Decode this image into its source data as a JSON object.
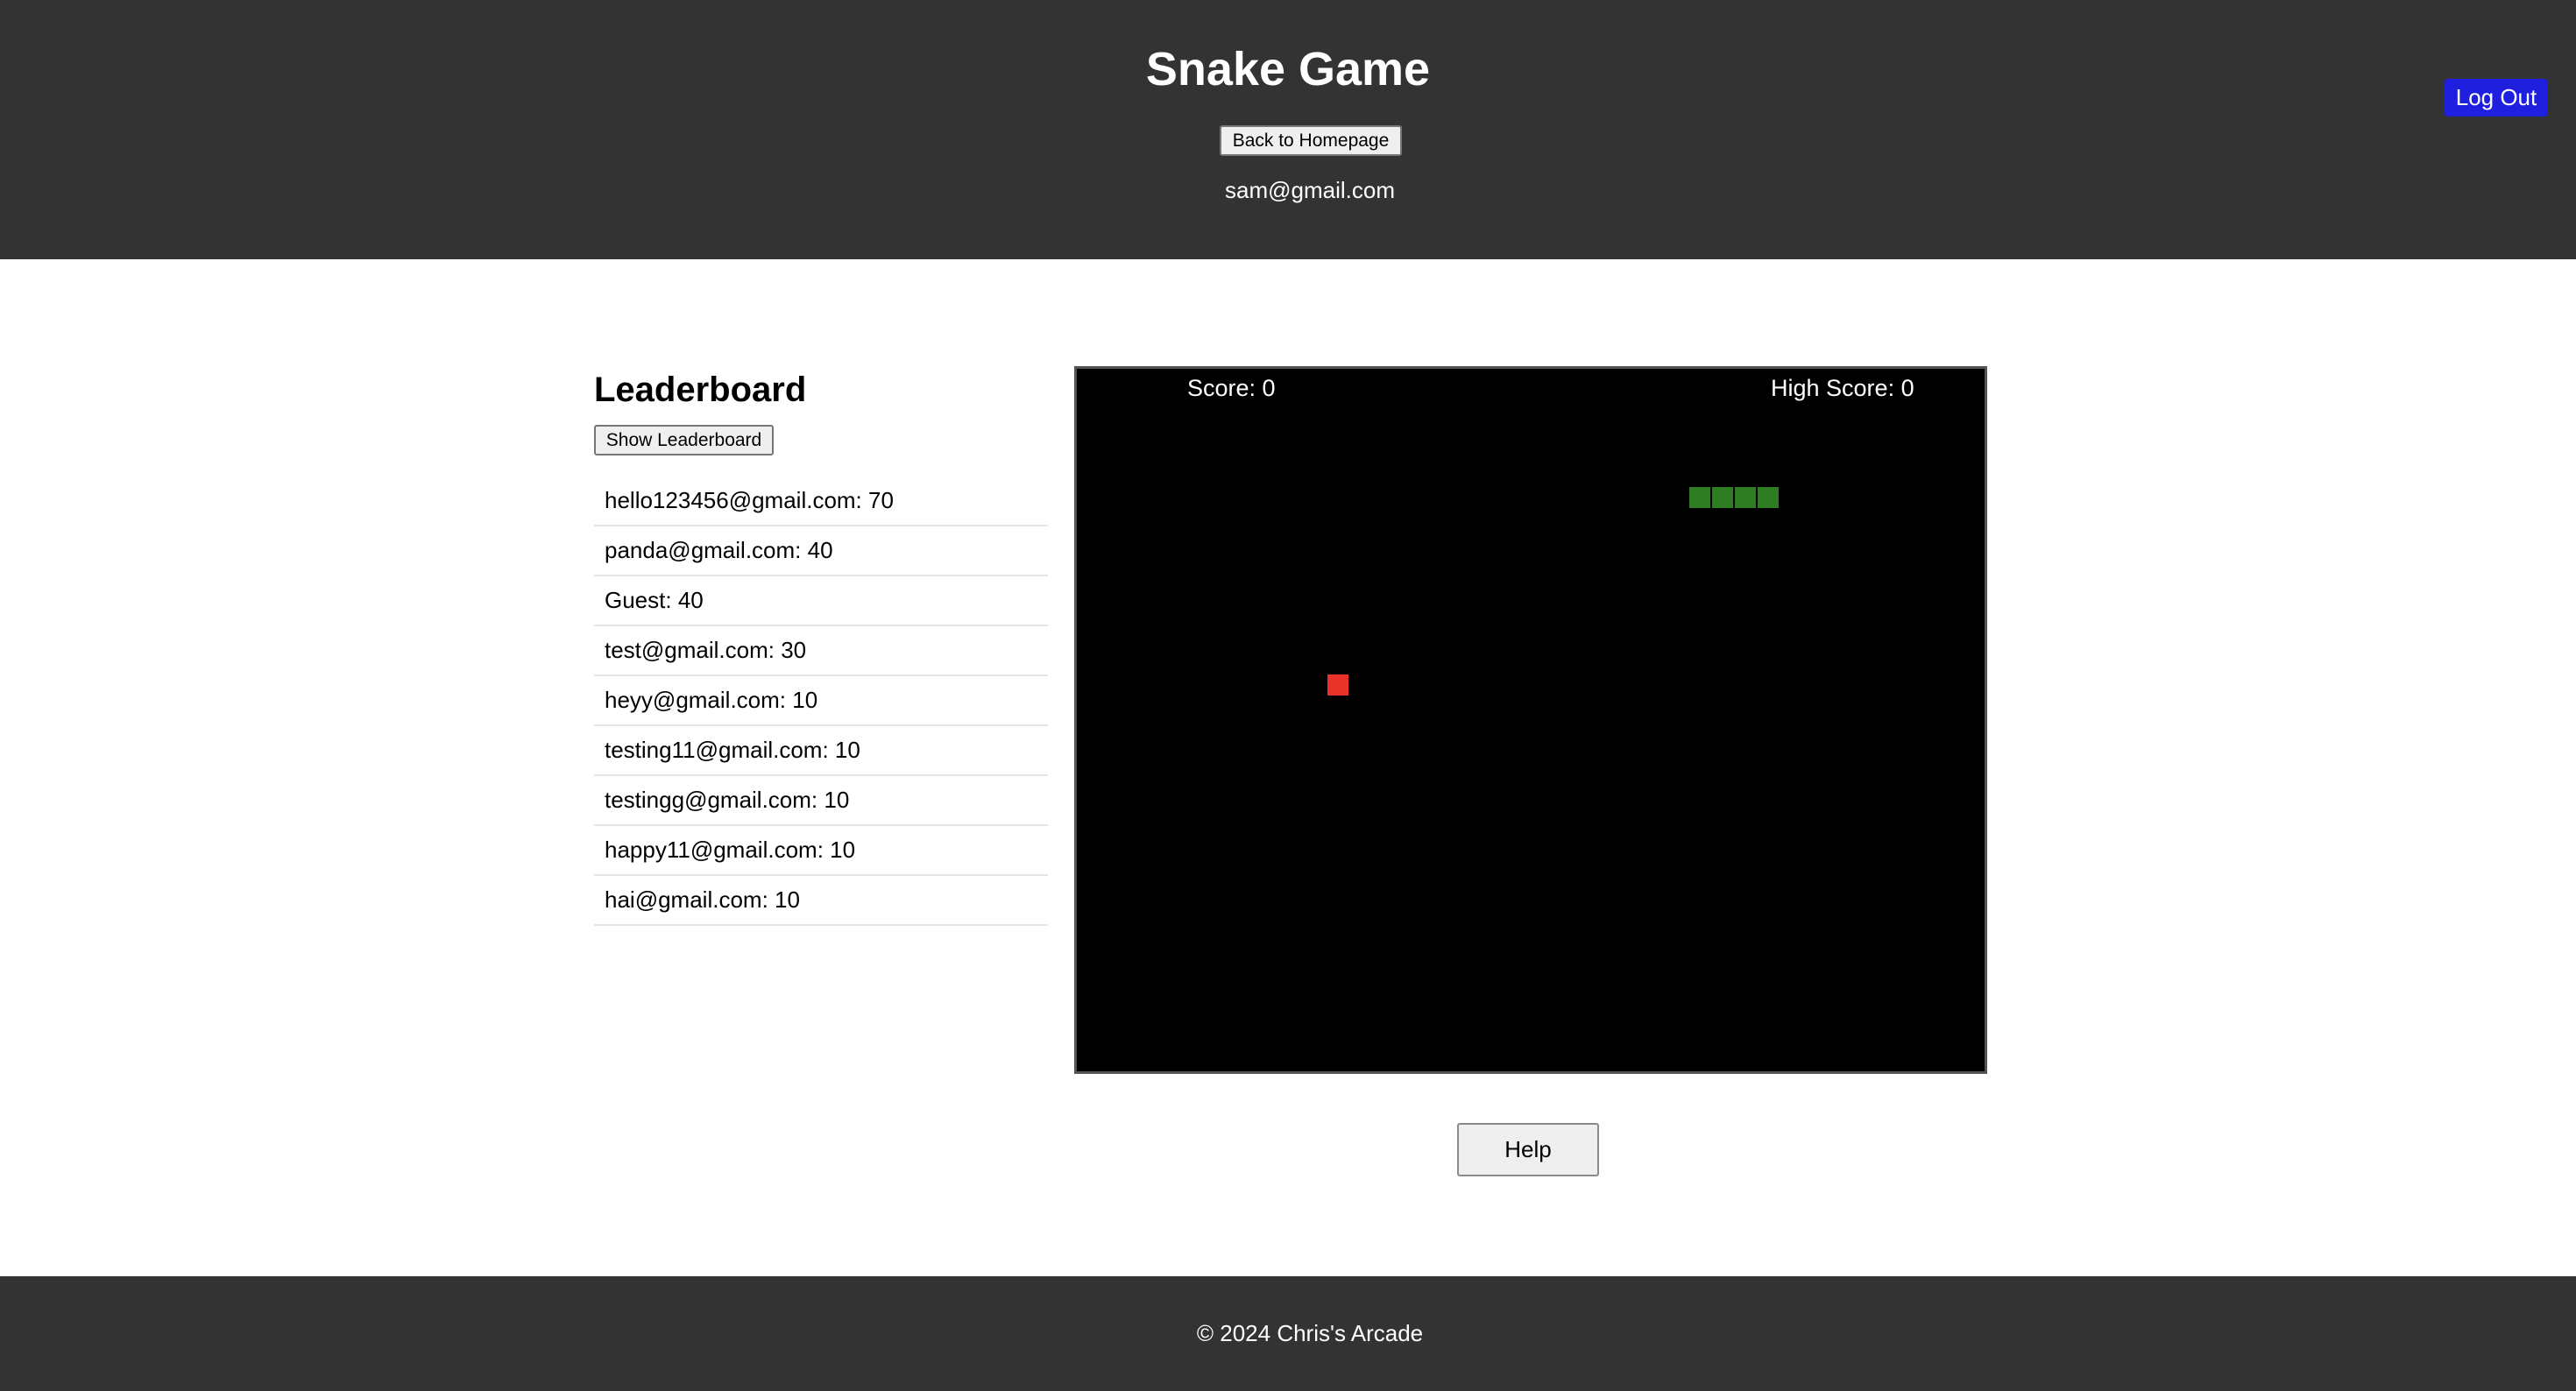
{
  "header": {
    "title": "Snake Game",
    "back_label": "Back to Homepage",
    "user_email": "sam@gmail.com",
    "logout_label": "Log Out"
  },
  "leaderboard": {
    "title": "Leaderboard",
    "toggle_label": "Show Leaderboard",
    "entries": [
      "hello123456@gmail.com: 70",
      "panda@gmail.com: 40",
      "Guest: 40",
      "test@gmail.com: 30",
      "heyy@gmail.com: 10",
      "testing11@gmail.com: 10",
      "testingg@gmail.com: 10",
      "happy11@gmail.com: 10",
      "hai@gmail.com: 10"
    ]
  },
  "game": {
    "score_text": "Score: 0",
    "high_score_text": "High Score: 0",
    "snake_color": "#2e7d23",
    "food_color": "#e8322a",
    "background_color": "#000000",
    "snake_length": 4
  },
  "help_label": "Help",
  "footer": {
    "text": "© 2024 Chris's Arcade"
  },
  "colors": {
    "header_bg": "#333333",
    "logout_bg": "#1f1fe0"
  }
}
